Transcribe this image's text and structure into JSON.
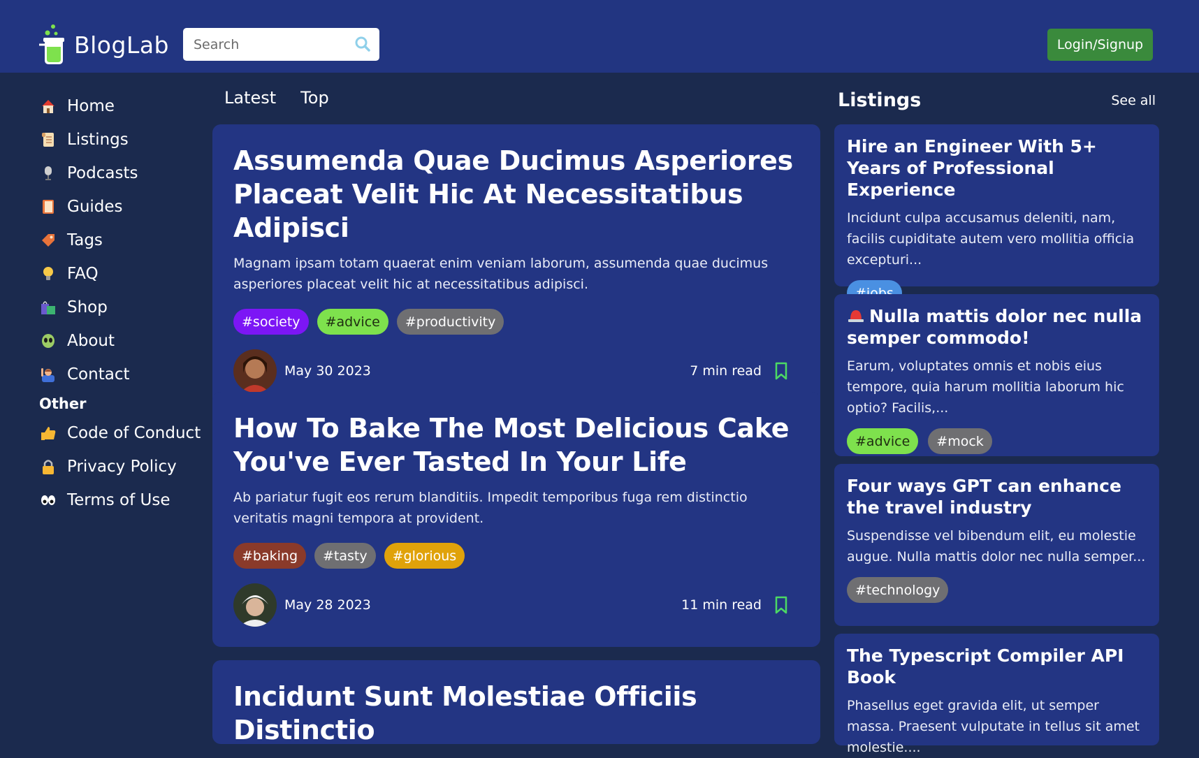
{
  "header": {
    "logo_text": "BlogLab",
    "search_placeholder": "Search",
    "login_label": "Login/Signup"
  },
  "sidebar": {
    "items": [
      {
        "label": "Home",
        "icon": "house-icon"
      },
      {
        "label": "Listings",
        "icon": "scroll-icon"
      },
      {
        "label": "Podcasts",
        "icon": "microphone-icon"
      },
      {
        "label": "Guides",
        "icon": "book-icon"
      },
      {
        "label": "Tags",
        "icon": "tag-icon"
      },
      {
        "label": "FAQ",
        "icon": "lightbulb-icon"
      },
      {
        "label": "Shop",
        "icon": "shopping-bags-icon"
      },
      {
        "label": "About",
        "icon": "alien-icon"
      },
      {
        "label": "Contact",
        "icon": "person-raising-hand-icon"
      }
    ],
    "other_heading": "Other",
    "other_items": [
      {
        "label": "Code of Conduct",
        "icon": "thumbs-up-icon"
      },
      {
        "label": "Privacy Policy",
        "icon": "lock-icon"
      },
      {
        "label": "Terms of Use",
        "icon": "eyes-icon"
      }
    ]
  },
  "feed": {
    "tabs": [
      "Latest",
      "Top"
    ],
    "posts": [
      {
        "title": "Assumenda Quae Ducimus Asperiores Placeat Velit Hic At Necessitatibus Adipisci",
        "excerpt": "Magnam ipsam totam quaerat enim veniam laborum, assumenda quae ducimus asperiores placeat velit hic at necessitatibus adipisci.",
        "tags": [
          {
            "label": "#society",
            "bg": "#7c16f5",
            "fg": "#ffffff"
          },
          {
            "label": "#advice",
            "bg": "#7ee14d",
            "fg": "#1f2e12"
          },
          {
            "label": "#productivity",
            "bg": "#6f6f72",
            "fg": "#ffffff"
          }
        ],
        "date": "May 30 2023",
        "read_time": "7 min read"
      },
      {
        "title": "How To Bake The Most Delicious Cake You've Ever Tasted In Your Life",
        "excerpt": "Ab pariatur fugit eos rerum blanditiis. Impedit temporibus fuga rem distinctio veritatis magni tempora at provident.",
        "tags": [
          {
            "label": "#baking",
            "bg": "#8a3a2a",
            "fg": "#ffffff"
          },
          {
            "label": "#tasty",
            "bg": "#6f6f72",
            "fg": "#ffffff"
          },
          {
            "label": "#glorious",
            "bg": "#e0a20a",
            "fg": "#ffffff"
          }
        ],
        "date": "May 28 2023",
        "read_time": "11 min read"
      },
      {
        "title": "Incidunt Sunt Molestiae Officiis Distinctio"
      }
    ]
  },
  "listings": {
    "heading": "Listings",
    "see_all": "See all",
    "items": [
      {
        "title": "Hire an Engineer With 5+ Years of Professional Experience",
        "body": "Incidunt culpa accusamus deleniti, nam, facilis cupiditate autem vero mollitia officia excepturi...",
        "tags": [
          {
            "label": "#jobs",
            "bg": "#4a90e2",
            "fg": "#ffffff"
          }
        ]
      },
      {
        "title": "Nulla mattis dolor nec nulla semper commodo!",
        "icon": "siren-icon",
        "body": "Earum, voluptates omnis et nobis eius tempore, quia harum mollitia laborum hic optio? Facilis,...",
        "tags": [
          {
            "label": "#advice",
            "bg": "#7ee14d",
            "fg": "#1f2e12"
          },
          {
            "label": "#mock",
            "bg": "#6f6f72",
            "fg": "#ffffff"
          }
        ]
      },
      {
        "title": "Four ways GPT can enhance the travel industry",
        "body": "Suspendisse vel bibendum elit, eu molestie augue. Nulla mattis dolor nec nulla semper...",
        "tags": [
          {
            "label": "#technology",
            "bg": "#6f6f72",
            "fg": "#ffffff"
          }
        ]
      },
      {
        "title": "The Typescript Compiler API Book",
        "body": "Phasellus eget gravida elit, ut semper massa. Praesent vulputate in tellus sit amet molestie...."
      }
    ]
  },
  "colors": {
    "background": "#1b2a4e",
    "header": "#223581",
    "card": "#233583",
    "accent_green": "#3a8a3c",
    "bookmark": "#4cd964"
  }
}
